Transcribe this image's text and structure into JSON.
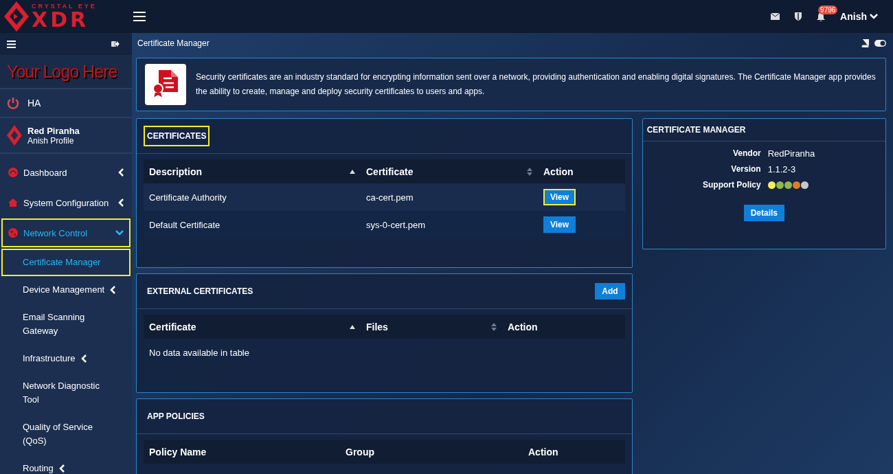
{
  "topbar": {
    "brand_small": "CRYSTAL EYE",
    "brand_large": "XDR",
    "notification_count": "9796",
    "user": "Anish"
  },
  "sidebar": {
    "logo_text": "Your Logo Here",
    "ha_label": "HA",
    "profile": {
      "name": "Red Piranha",
      "subtitle": "Anish Profile"
    },
    "items": [
      {
        "label": "Dashboard",
        "kind": "section",
        "expanded": false,
        "active": false,
        "highlighted": false
      },
      {
        "label": "System Configuration",
        "kind": "section",
        "expanded": false,
        "active": false,
        "highlighted": false
      },
      {
        "label": "Network Control",
        "kind": "section",
        "expanded": true,
        "active": true,
        "highlighted": true
      },
      {
        "label": "Certificate Manager",
        "kind": "sub",
        "has_children": false,
        "active": true,
        "highlighted": true
      },
      {
        "label": "Device Management",
        "kind": "sub",
        "has_children": true,
        "active": false,
        "highlighted": false
      },
      {
        "label": "Email Scanning Gateway",
        "kind": "sub",
        "has_children": false,
        "active": false,
        "highlighted": false
      },
      {
        "label": "Infrastructure",
        "kind": "sub",
        "has_children": true,
        "active": false,
        "highlighted": false
      },
      {
        "label": "Network Diagnostic Tool",
        "kind": "sub",
        "has_children": false,
        "active": false,
        "highlighted": false
      },
      {
        "label": "Quality of Service (QoS)",
        "kind": "sub",
        "has_children": false,
        "active": false,
        "highlighted": false
      },
      {
        "label": "Routing",
        "kind": "sub",
        "has_children": true,
        "active": false,
        "highlighted": false
      }
    ]
  },
  "breadcrumb": "Certificate Manager",
  "intro": "Security certificates are an industry standard for encrypting information sent over a network, providing authentication and enabling digital signatures. The Certificate Manager app provides the ability to create, manage and deploy security certificates to users and apps.",
  "certificates": {
    "title": "CERTIFICATES",
    "highlighted": true,
    "columns": [
      {
        "label": "Description",
        "kind": "sorted"
      },
      {
        "label": "Certificate",
        "kind": "sortable"
      },
      {
        "label": "Action",
        "kind": "plain"
      }
    ],
    "rows": [
      {
        "description": "Certificate Authority",
        "certificate": "ca-cert.pem",
        "action": "View",
        "highlighted": true
      },
      {
        "description": "Default Certificate",
        "certificate": "sys-0-cert.pem",
        "action": "View",
        "highlighted": false
      }
    ]
  },
  "external_certificates": {
    "title": "EXTERNAL CERTIFICATES",
    "add_button": "Add",
    "columns": [
      {
        "label": "Certificate",
        "kind": "sorted"
      },
      {
        "label": "Files",
        "kind": "sortable"
      },
      {
        "label": "Action",
        "kind": "plain"
      }
    ],
    "empty_message": "No data available in table"
  },
  "app_policies": {
    "title": "APP POLICIES",
    "columns": [
      {
        "label": "Policy Name",
        "kind": "plain"
      },
      {
        "label": "Group",
        "kind": "plain"
      },
      {
        "label": "Action",
        "kind": "plain"
      }
    ]
  },
  "info_panel": {
    "title": "CERTIFICATE MANAGER",
    "fields": [
      {
        "label": "Vendor",
        "value": "RedPiranha"
      },
      {
        "label": "Version",
        "value": "1.1.2-3"
      }
    ],
    "support_policy_label": "Support Policy",
    "support_dots": [
      {
        "color": "#f3ef5a"
      },
      {
        "color": "#8fb84e"
      },
      {
        "color": "#8fb84e"
      },
      {
        "color": "#e07b2c"
      },
      {
        "color": "#c8c8c8"
      }
    ],
    "details_button": "Details"
  }
}
